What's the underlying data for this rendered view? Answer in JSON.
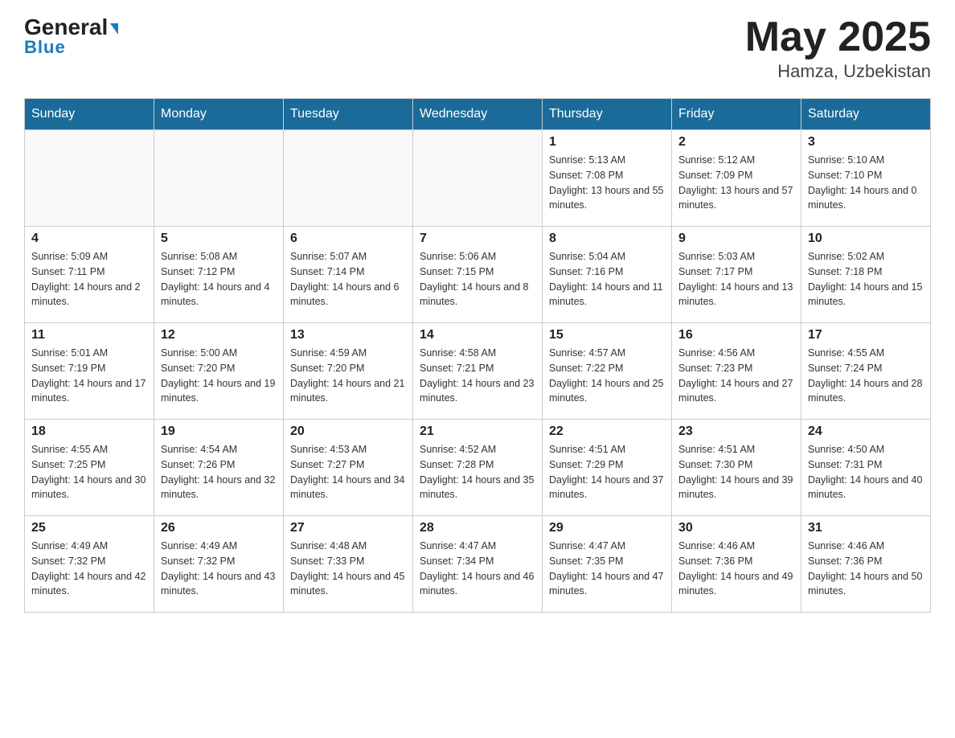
{
  "header": {
    "logo_line1": "General",
    "logo_line2": "Blue",
    "month": "May 2025",
    "location": "Hamza, Uzbekistan"
  },
  "weekdays": [
    "Sunday",
    "Monday",
    "Tuesday",
    "Wednesday",
    "Thursday",
    "Friday",
    "Saturday"
  ],
  "weeks": [
    [
      {
        "day": "",
        "sunrise": "",
        "sunset": "",
        "daylight": ""
      },
      {
        "day": "",
        "sunrise": "",
        "sunset": "",
        "daylight": ""
      },
      {
        "day": "",
        "sunrise": "",
        "sunset": "",
        "daylight": ""
      },
      {
        "day": "",
        "sunrise": "",
        "sunset": "",
        "daylight": ""
      },
      {
        "day": "1",
        "sunrise": "Sunrise: 5:13 AM",
        "sunset": "Sunset: 7:08 PM",
        "daylight": "Daylight: 13 hours and 55 minutes."
      },
      {
        "day": "2",
        "sunrise": "Sunrise: 5:12 AM",
        "sunset": "Sunset: 7:09 PM",
        "daylight": "Daylight: 13 hours and 57 minutes."
      },
      {
        "day": "3",
        "sunrise": "Sunrise: 5:10 AM",
        "sunset": "Sunset: 7:10 PM",
        "daylight": "Daylight: 14 hours and 0 minutes."
      }
    ],
    [
      {
        "day": "4",
        "sunrise": "Sunrise: 5:09 AM",
        "sunset": "Sunset: 7:11 PM",
        "daylight": "Daylight: 14 hours and 2 minutes."
      },
      {
        "day": "5",
        "sunrise": "Sunrise: 5:08 AM",
        "sunset": "Sunset: 7:12 PM",
        "daylight": "Daylight: 14 hours and 4 minutes."
      },
      {
        "day": "6",
        "sunrise": "Sunrise: 5:07 AM",
        "sunset": "Sunset: 7:14 PM",
        "daylight": "Daylight: 14 hours and 6 minutes."
      },
      {
        "day": "7",
        "sunrise": "Sunrise: 5:06 AM",
        "sunset": "Sunset: 7:15 PM",
        "daylight": "Daylight: 14 hours and 8 minutes."
      },
      {
        "day": "8",
        "sunrise": "Sunrise: 5:04 AM",
        "sunset": "Sunset: 7:16 PM",
        "daylight": "Daylight: 14 hours and 11 minutes."
      },
      {
        "day": "9",
        "sunrise": "Sunrise: 5:03 AM",
        "sunset": "Sunset: 7:17 PM",
        "daylight": "Daylight: 14 hours and 13 minutes."
      },
      {
        "day": "10",
        "sunrise": "Sunrise: 5:02 AM",
        "sunset": "Sunset: 7:18 PM",
        "daylight": "Daylight: 14 hours and 15 minutes."
      }
    ],
    [
      {
        "day": "11",
        "sunrise": "Sunrise: 5:01 AM",
        "sunset": "Sunset: 7:19 PM",
        "daylight": "Daylight: 14 hours and 17 minutes."
      },
      {
        "day": "12",
        "sunrise": "Sunrise: 5:00 AM",
        "sunset": "Sunset: 7:20 PM",
        "daylight": "Daylight: 14 hours and 19 minutes."
      },
      {
        "day": "13",
        "sunrise": "Sunrise: 4:59 AM",
        "sunset": "Sunset: 7:20 PM",
        "daylight": "Daylight: 14 hours and 21 minutes."
      },
      {
        "day": "14",
        "sunrise": "Sunrise: 4:58 AM",
        "sunset": "Sunset: 7:21 PM",
        "daylight": "Daylight: 14 hours and 23 minutes."
      },
      {
        "day": "15",
        "sunrise": "Sunrise: 4:57 AM",
        "sunset": "Sunset: 7:22 PM",
        "daylight": "Daylight: 14 hours and 25 minutes."
      },
      {
        "day": "16",
        "sunrise": "Sunrise: 4:56 AM",
        "sunset": "Sunset: 7:23 PM",
        "daylight": "Daylight: 14 hours and 27 minutes."
      },
      {
        "day": "17",
        "sunrise": "Sunrise: 4:55 AM",
        "sunset": "Sunset: 7:24 PM",
        "daylight": "Daylight: 14 hours and 28 minutes."
      }
    ],
    [
      {
        "day": "18",
        "sunrise": "Sunrise: 4:55 AM",
        "sunset": "Sunset: 7:25 PM",
        "daylight": "Daylight: 14 hours and 30 minutes."
      },
      {
        "day": "19",
        "sunrise": "Sunrise: 4:54 AM",
        "sunset": "Sunset: 7:26 PM",
        "daylight": "Daylight: 14 hours and 32 minutes."
      },
      {
        "day": "20",
        "sunrise": "Sunrise: 4:53 AM",
        "sunset": "Sunset: 7:27 PM",
        "daylight": "Daylight: 14 hours and 34 minutes."
      },
      {
        "day": "21",
        "sunrise": "Sunrise: 4:52 AM",
        "sunset": "Sunset: 7:28 PM",
        "daylight": "Daylight: 14 hours and 35 minutes."
      },
      {
        "day": "22",
        "sunrise": "Sunrise: 4:51 AM",
        "sunset": "Sunset: 7:29 PM",
        "daylight": "Daylight: 14 hours and 37 minutes."
      },
      {
        "day": "23",
        "sunrise": "Sunrise: 4:51 AM",
        "sunset": "Sunset: 7:30 PM",
        "daylight": "Daylight: 14 hours and 39 minutes."
      },
      {
        "day": "24",
        "sunrise": "Sunrise: 4:50 AM",
        "sunset": "Sunset: 7:31 PM",
        "daylight": "Daylight: 14 hours and 40 minutes."
      }
    ],
    [
      {
        "day": "25",
        "sunrise": "Sunrise: 4:49 AM",
        "sunset": "Sunset: 7:32 PM",
        "daylight": "Daylight: 14 hours and 42 minutes."
      },
      {
        "day": "26",
        "sunrise": "Sunrise: 4:49 AM",
        "sunset": "Sunset: 7:32 PM",
        "daylight": "Daylight: 14 hours and 43 minutes."
      },
      {
        "day": "27",
        "sunrise": "Sunrise: 4:48 AM",
        "sunset": "Sunset: 7:33 PM",
        "daylight": "Daylight: 14 hours and 45 minutes."
      },
      {
        "day": "28",
        "sunrise": "Sunrise: 4:47 AM",
        "sunset": "Sunset: 7:34 PM",
        "daylight": "Daylight: 14 hours and 46 minutes."
      },
      {
        "day": "29",
        "sunrise": "Sunrise: 4:47 AM",
        "sunset": "Sunset: 7:35 PM",
        "daylight": "Daylight: 14 hours and 47 minutes."
      },
      {
        "day": "30",
        "sunrise": "Sunrise: 4:46 AM",
        "sunset": "Sunset: 7:36 PM",
        "daylight": "Daylight: 14 hours and 49 minutes."
      },
      {
        "day": "31",
        "sunrise": "Sunrise: 4:46 AM",
        "sunset": "Sunset: 7:36 PM",
        "daylight": "Daylight: 14 hours and 50 minutes."
      }
    ]
  ]
}
